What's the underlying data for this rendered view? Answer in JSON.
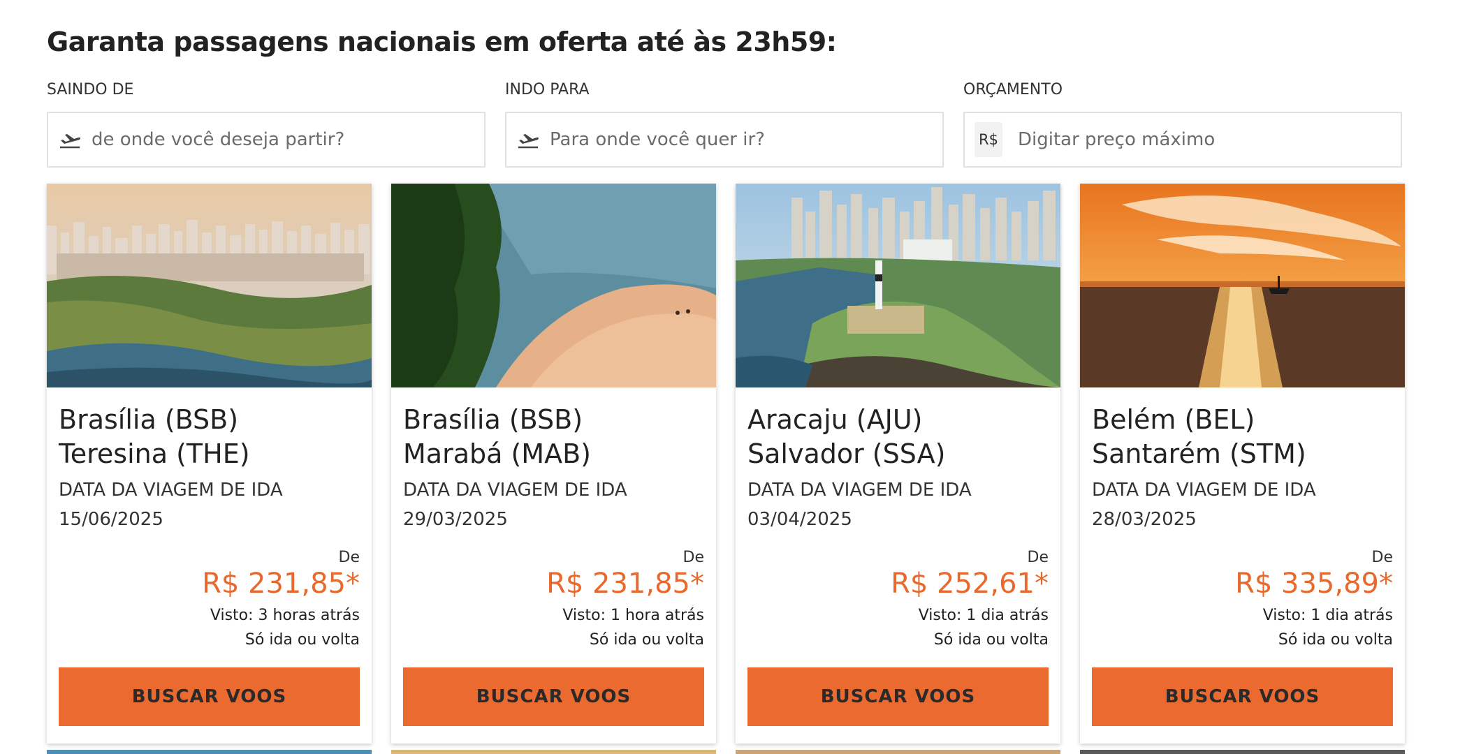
{
  "heading": "Garanta passagens nacionais em oferta até às 23h59:",
  "filters": {
    "origin": {
      "label": "SAINDO DE",
      "placeholder": "de onde você deseja partir?",
      "icon": "plane-takeoff-icon"
    },
    "destination": {
      "label": "INDO PARA",
      "placeholder": "Para onde você quer ir?",
      "icon": "plane-takeoff-icon"
    },
    "budget": {
      "label": "ORÇAMENTO",
      "currency": "R$",
      "placeholder": "Digitar preço máximo"
    }
  },
  "cards": [
    {
      "origin": "Brasília (BSB)",
      "destination": "Teresina (THE)",
      "date_label": "DATA DA VIAGEM DE IDA",
      "date": "15/06/2025",
      "from_label": "De",
      "price": "R$ 231,85*",
      "seen": "Visto: 3 horas atrás",
      "trip_type": "Só ida ou volta",
      "button": "BUSCAR VOOS"
    },
    {
      "origin": "Brasília (BSB)",
      "destination": "Marabá (MAB)",
      "date_label": "DATA DA VIAGEM DE IDA",
      "date": "29/03/2025",
      "from_label": "De",
      "price": "R$ 231,85*",
      "seen": "Visto: 1 hora atrás",
      "trip_type": "Só ida ou volta",
      "button": "BUSCAR VOOS"
    },
    {
      "origin": "Aracaju (AJU)",
      "destination": "Salvador (SSA)",
      "date_label": "DATA DA VIAGEM DE IDA",
      "date": "03/04/2025",
      "from_label": "De",
      "price": "R$ 252,61*",
      "seen": "Visto: 1 dia atrás",
      "trip_type": "Só ida ou volta",
      "button": "BUSCAR VOOS"
    },
    {
      "origin": "Belém (BEL)",
      "destination": "Santarém (STM)",
      "date_label": "DATA DA VIAGEM DE IDA",
      "date": "28/03/2025",
      "from_label": "De",
      "price": "R$ 335,89*",
      "seen": "Visto: 1 dia atrás",
      "trip_type": "Só ida ou volta",
      "button": "BUSCAR VOOS"
    }
  ],
  "colors": {
    "accent": "#eb6a2f",
    "price": "#e8692d",
    "border": "#e1e1e1"
  }
}
